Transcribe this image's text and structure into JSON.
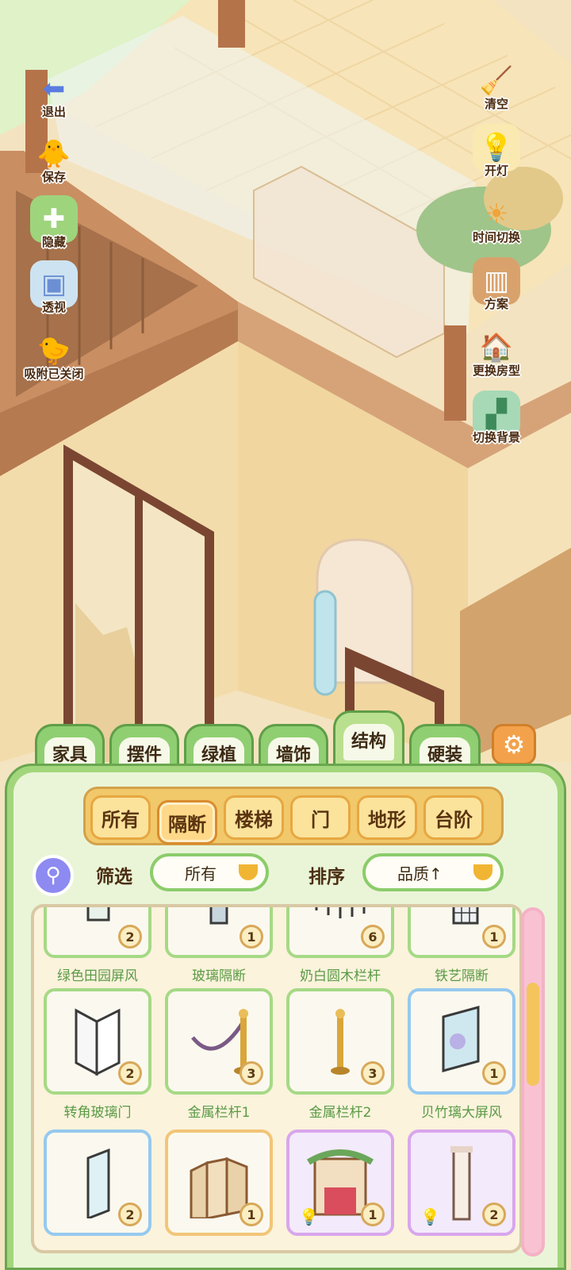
{
  "sidebar_left": [
    {
      "label": "退出",
      "icon": "exit-arrow-icon"
    },
    {
      "label": "保存",
      "icon": "save-chick-icon"
    },
    {
      "label": "隐藏",
      "icon": "hide-icon"
    },
    {
      "label": "透视",
      "icon": "perspective-cube-icon"
    },
    {
      "label": "吸附已关闭",
      "icon": "snap-chicks-icon"
    }
  ],
  "sidebar_right": [
    {
      "label": "清空",
      "icon": "clear-icon"
    },
    {
      "label": "开灯",
      "icon": "light-icon"
    },
    {
      "label": "时间切换",
      "icon": "time-switch-icon"
    },
    {
      "label": "方案",
      "icon": "plan-icon"
    },
    {
      "label": "更换房型",
      "icon": "house-icon"
    },
    {
      "label": "切换背景",
      "icon": "background-icon"
    }
  ],
  "category_tabs": [
    {
      "label": "家具",
      "active": false
    },
    {
      "label": "摆件",
      "active": false
    },
    {
      "label": "绿植",
      "active": false
    },
    {
      "label": "墙饰",
      "active": false
    },
    {
      "label": "结构",
      "active": true
    },
    {
      "label": "硬装",
      "active": false
    }
  ],
  "sub_tabs": [
    {
      "label": "所有",
      "active": false
    },
    {
      "label": "隔断",
      "active": true
    },
    {
      "label": "楼梯",
      "active": false
    },
    {
      "label": "门",
      "active": false
    },
    {
      "label": "地形",
      "active": false
    },
    {
      "label": "台阶",
      "active": false
    }
  ],
  "filter": {
    "label": "筛选",
    "value": "所有"
  },
  "sort": {
    "label": "排序",
    "value": "品质↑"
  },
  "items": [
    {
      "name": "绿色田园屏风",
      "count": "2",
      "border": "green",
      "icon": "screen-partial-icon"
    },
    {
      "name": "玻璃隔断",
      "count": "1",
      "border": "green",
      "icon": "glass-partition-icon"
    },
    {
      "name": "奶白圆木栏杆",
      "count": "6",
      "border": "green",
      "icon": "railing-icon"
    },
    {
      "name": "铁艺隔断",
      "count": "1",
      "border": "green",
      "icon": "iron-partition-icon"
    },
    {
      "name": "转角玻璃门",
      "count": "2",
      "border": "green",
      "icon": "corner-glass-door-icon"
    },
    {
      "name": "金属栏杆1",
      "count": "3",
      "border": "green",
      "icon": "rope-barrier-icon"
    },
    {
      "name": "金属栏杆2",
      "count": "3",
      "border": "green",
      "icon": "metal-post-icon"
    },
    {
      "name": "贝竹璃大屏风",
      "count": "1",
      "border": "blue",
      "icon": "large-screen-icon"
    },
    {
      "name": "",
      "count": "2",
      "border": "blue",
      "icon": "banner-screen-icon"
    },
    {
      "name": "",
      "count": "1",
      "border": "orange",
      "icon": "folding-screen-icon"
    },
    {
      "name": "",
      "count": "1",
      "border": "purple",
      "icon": "flower-arch-icon",
      "bulb": true
    },
    {
      "name": "",
      "count": "2",
      "border": "purple",
      "icon": "pillar-screen-icon",
      "bulb": true
    }
  ],
  "scroll_fraction": 0.3
}
